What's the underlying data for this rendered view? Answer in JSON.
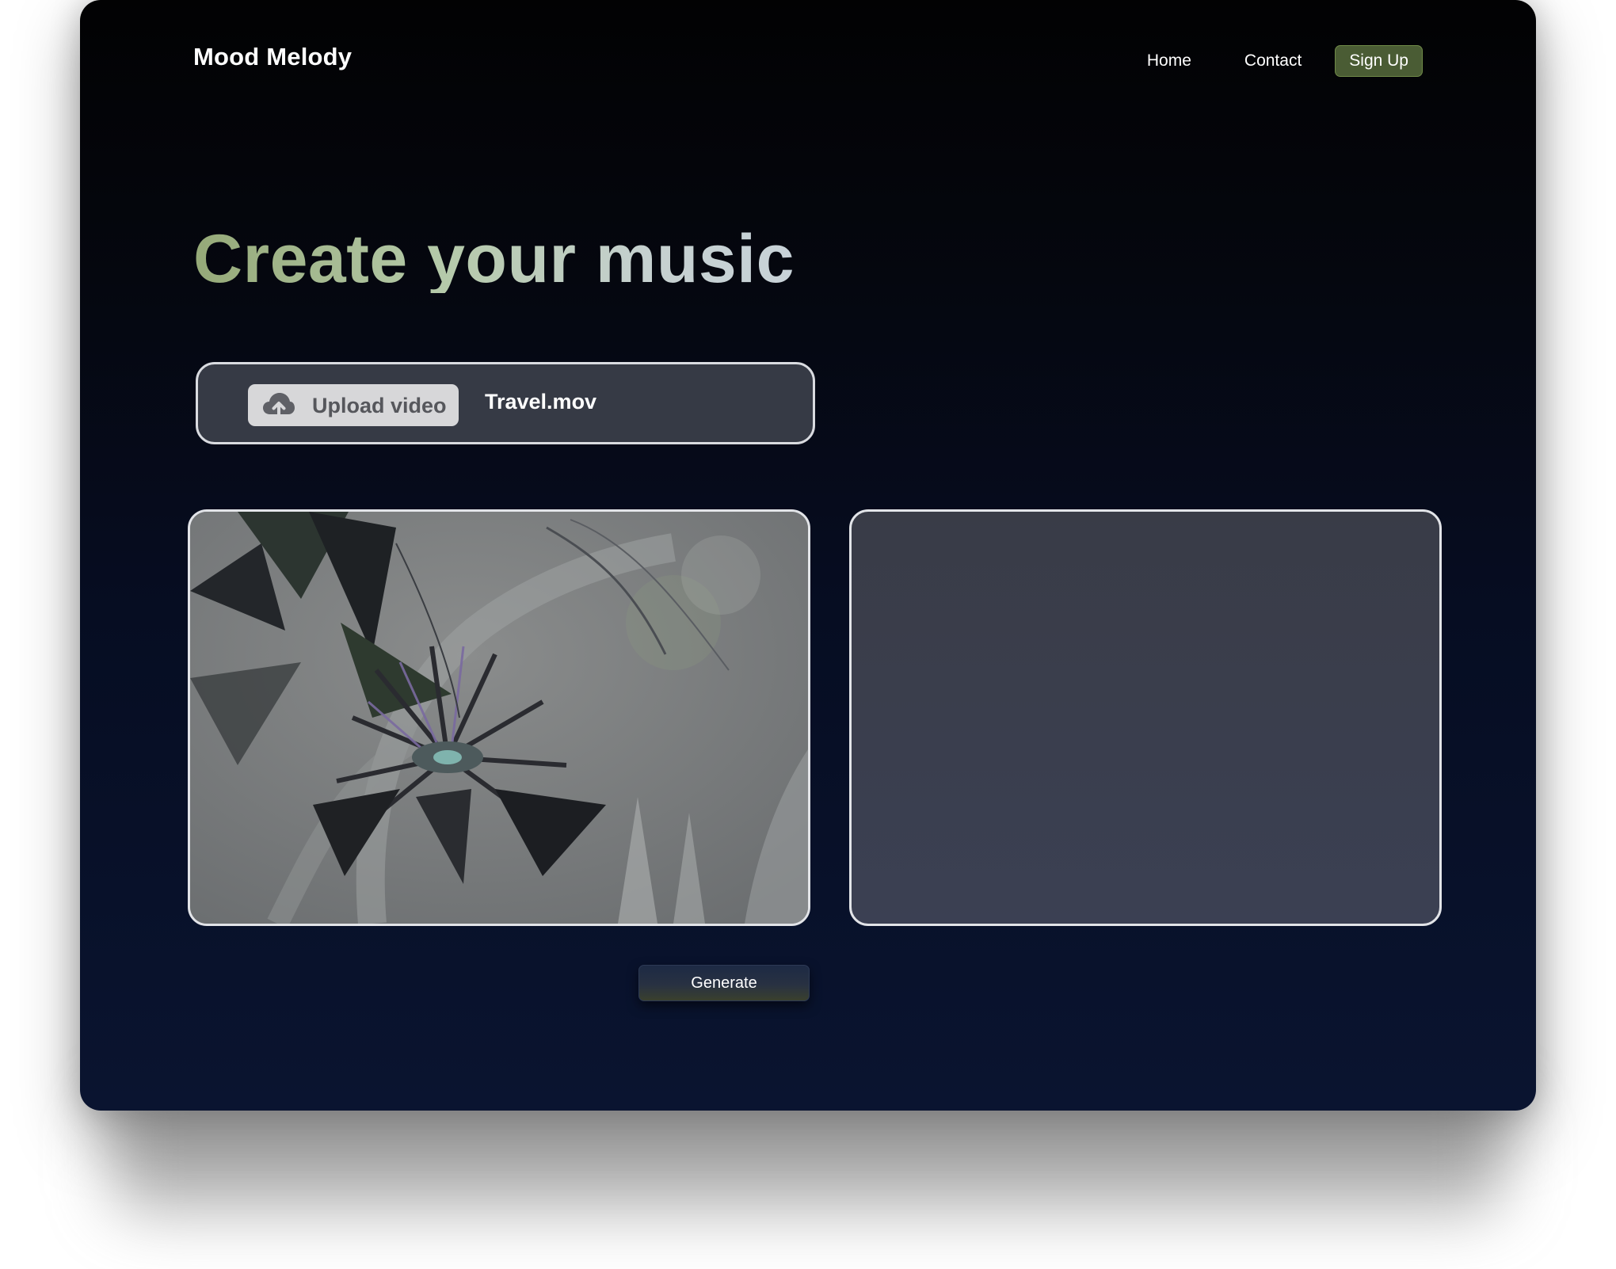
{
  "nav": {
    "brand": "Mood Melody",
    "links": [
      "Home",
      "Contact"
    ],
    "signup_label": "Sign Up"
  },
  "hero": {
    "title": "Create your music"
  },
  "upload": {
    "button_label": "Upload video",
    "icon": "cloud-upload-icon",
    "filename": "Travel.mov"
  },
  "preview": {
    "image_alt": "abstract flower artwork"
  },
  "actions": {
    "generate_label": "Generate"
  },
  "colors": {
    "accent_green": "#4a5c34",
    "panel_bg": "#393c47",
    "background_top": "#020203",
    "background_bottom": "#0a1430"
  }
}
